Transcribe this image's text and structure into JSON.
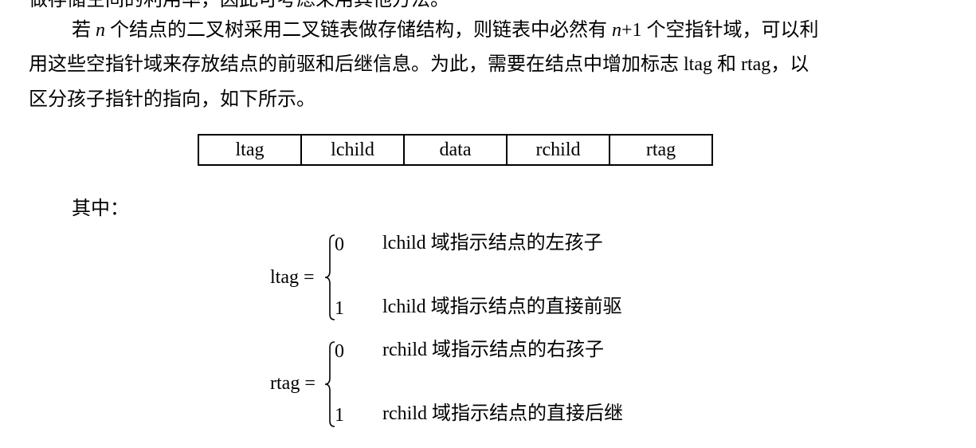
{
  "paragraph": {
    "line_0": "做存储空间的利用率，因此可考虑采用其他方法。",
    "line_1_pre": "若 ",
    "line_1_var": "n",
    "line_1_mid": " 个结点的二叉树采用二叉链表做存储结构，则链表中必然有 ",
    "line_1_var2": "n",
    "line_1_post": "+1 个空指针域，可以利",
    "line_2": "用这些空指针域来存放结点的前驱和后继信息。为此，需要在结点中增加标志 ltag 和 rtag，以",
    "line_3": "区分孩子指针的指向，如下所示。"
  },
  "node_structure": [
    "ltag",
    "lchild",
    "data",
    "rchild",
    "rtag"
  ],
  "where_label": "其中：",
  "definitions": [
    {
      "name": "ltag =",
      "cases": [
        {
          "value": "0",
          "meaning": "lchild 域指示结点的左孩子"
        },
        {
          "value": "1",
          "meaning": "lchild 域指示结点的直接前驱"
        }
      ]
    },
    {
      "name": "rtag =",
      "cases": [
        {
          "value": "0",
          "meaning": "rchild 域指示结点的右孩子"
        },
        {
          "value": "1",
          "meaning": "rchild 域指示结点的直接后继"
        }
      ]
    }
  ]
}
